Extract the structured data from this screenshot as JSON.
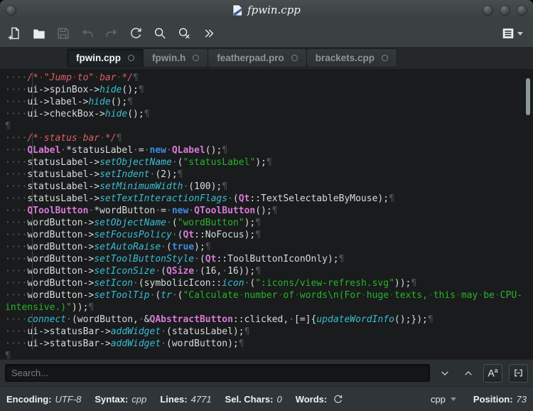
{
  "window": {
    "title": "fpwin.cpp"
  },
  "titlebar": {
    "left_buttons": [
      {
        "name": "window-menu-button"
      }
    ],
    "right_buttons": [
      {
        "name": "minimize-button"
      },
      {
        "name": "maximize-button"
      },
      {
        "name": "close-button"
      }
    ],
    "title_icon": "featherpad-document-icon"
  },
  "toolbar": {
    "buttons": [
      {
        "name": "new-file",
        "icon": "new-file-icon",
        "enabled": true
      },
      {
        "name": "open-file",
        "icon": "open-folder-icon",
        "enabled": true
      },
      {
        "name": "save",
        "icon": "save-icon",
        "enabled": false
      },
      {
        "name": "undo",
        "icon": "undo-icon",
        "enabled": false
      },
      {
        "name": "redo",
        "icon": "redo-icon",
        "enabled": false
      },
      {
        "name": "reload",
        "icon": "reload-icon",
        "enabled": true
      },
      {
        "name": "search",
        "icon": "search-icon",
        "enabled": true
      },
      {
        "name": "find-replace",
        "icon": "find-replace-icon",
        "enabled": true
      },
      {
        "name": "more-tools",
        "icon": "double-chevron-icon",
        "enabled": true
      }
    ],
    "menu_button_icon": "hamburger-menu-icon"
  },
  "tabs": [
    {
      "label": "fpwin.cpp",
      "active": true
    },
    {
      "label": "fpwin.h",
      "active": false
    },
    {
      "label": "featherpad.pro",
      "active": false
    },
    {
      "label": "brackets.cpp",
      "active": false
    }
  ],
  "editor": {
    "colors": {
      "editor-bg": "#191b1c",
      "plain": "#d8dbdc",
      "comment": "#e25f66",
      "string": "#2ab32a",
      "keyword": "#3f8de4",
      "type": "#d77ad7",
      "func": "#3bbcd2"
    },
    "lines": [
      {
        "i": 4,
        "t": [
          [
            "c",
            "/* \"Jump to\" bar */"
          ]
        ],
        "n": true
      },
      {
        "i": 4,
        "t": [
          [
            "p",
            "ui->spinBox->"
          ],
          [
            "f",
            "hide"
          ],
          [
            "p",
            "();"
          ]
        ],
        "n": true
      },
      {
        "i": 4,
        "t": [
          [
            "p",
            "ui->label->"
          ],
          [
            "f",
            "hide"
          ],
          [
            "p",
            "();"
          ]
        ],
        "n": true
      },
      {
        "i": 4,
        "t": [
          [
            "p",
            "ui->checkBox->"
          ],
          [
            "f",
            "hide"
          ],
          [
            "p",
            "();"
          ]
        ],
        "n": true
      },
      {
        "i": 0,
        "t": [],
        "n": true
      },
      {
        "i": 4,
        "t": [
          [
            "c",
            "/* status bar */"
          ]
        ],
        "n": true
      },
      {
        "i": 4,
        "t": [
          [
            "t",
            "QLabel"
          ],
          [
            "p",
            " *statusLabel = "
          ],
          [
            "k",
            "new"
          ],
          [
            "p",
            " "
          ],
          [
            "t",
            "QLabel"
          ],
          [
            "p",
            "();"
          ]
        ],
        "n": true
      },
      {
        "i": 4,
        "t": [
          [
            "p",
            "statusLabel->"
          ],
          [
            "f",
            "setObjectName"
          ],
          [
            "p",
            " ("
          ],
          [
            "s",
            "\"statusLabel\""
          ],
          [
            "p",
            ");"
          ]
        ],
        "n": true
      },
      {
        "i": 4,
        "t": [
          [
            "p",
            "statusLabel->"
          ],
          [
            "f",
            "setIndent"
          ],
          [
            "p",
            " (2);"
          ]
        ],
        "n": true
      },
      {
        "i": 4,
        "t": [
          [
            "p",
            "statusLabel->"
          ],
          [
            "f",
            "setMinimumWidth"
          ],
          [
            "p",
            " (100);"
          ]
        ],
        "n": true
      },
      {
        "i": 4,
        "t": [
          [
            "p",
            "statusLabel->"
          ],
          [
            "f",
            "setTextInteractionFlags"
          ],
          [
            "p",
            " ("
          ],
          [
            "t",
            "Qt"
          ],
          [
            "p",
            "::TextSelectableByMouse);"
          ]
        ],
        "n": true
      },
      {
        "i": 4,
        "t": [
          [
            "t",
            "QToolButton"
          ],
          [
            "p",
            " *wordButton = "
          ],
          [
            "k",
            "new"
          ],
          [
            "p",
            " "
          ],
          [
            "t",
            "QToolButton"
          ],
          [
            "p",
            "();"
          ]
        ],
        "n": true
      },
      {
        "i": 4,
        "t": [
          [
            "p",
            "wordButton->"
          ],
          [
            "f",
            "setObjectName"
          ],
          [
            "p",
            " ("
          ],
          [
            "s",
            "\"wordButton\""
          ],
          [
            "p",
            ");"
          ]
        ],
        "n": true
      },
      {
        "i": 4,
        "t": [
          [
            "p",
            "wordButton->"
          ],
          [
            "f",
            "setFocusPolicy"
          ],
          [
            "p",
            " ("
          ],
          [
            "t",
            "Qt"
          ],
          [
            "p",
            "::NoFocus);"
          ]
        ],
        "n": true
      },
      {
        "i": 4,
        "t": [
          [
            "p",
            "wordButton->"
          ],
          [
            "f",
            "setAutoRaise"
          ],
          [
            "p",
            " ("
          ],
          [
            "k",
            "true"
          ],
          [
            "p",
            ");"
          ]
        ],
        "n": true
      },
      {
        "i": 4,
        "t": [
          [
            "p",
            "wordButton->"
          ],
          [
            "f",
            "setToolButtonStyle"
          ],
          [
            "p",
            " ("
          ],
          [
            "t",
            "Qt"
          ],
          [
            "p",
            "::ToolButtonIconOnly);"
          ]
        ],
        "n": true
      },
      {
        "i": 4,
        "t": [
          [
            "p",
            "wordButton->"
          ],
          [
            "f",
            "setIconSize"
          ],
          [
            "p",
            " ("
          ],
          [
            "t",
            "QSize"
          ],
          [
            "p",
            " (16, 16));"
          ]
        ],
        "n": true
      },
      {
        "i": 4,
        "t": [
          [
            "p",
            "wordButton->"
          ],
          [
            "f",
            "setIcon"
          ],
          [
            "p",
            " (symbolicIcon::"
          ],
          [
            "f",
            "icon"
          ],
          [
            "p",
            " ("
          ],
          [
            "s",
            "\":icons/view-refresh.svg\""
          ],
          [
            "p",
            "));"
          ]
        ],
        "n": true
      },
      {
        "i": 4,
        "t": [
          [
            "p",
            "wordButton->"
          ],
          [
            "f",
            "setToolTip"
          ],
          [
            "p",
            " ("
          ],
          [
            "f",
            "tr"
          ],
          [
            "p",
            " ("
          ],
          [
            "s",
            "\"Calculate number of words\\n(For huge texts, this may be CPU-"
          ]
        ],
        "n": false
      },
      {
        "i": 0,
        "t": [
          [
            "s",
            "intensive.)\""
          ],
          [
            "p",
            "));"
          ]
        ],
        "n": true
      },
      {
        "i": 4,
        "t": [
          [
            "f",
            "connect"
          ],
          [
            "p",
            " (wordButton, &"
          ],
          [
            "t",
            "QAbstractButton"
          ],
          [
            "p",
            "::clicked, [=]{"
          ],
          [
            "f",
            "updateWordInfo"
          ],
          [
            "p",
            "();});"
          ]
        ],
        "n": true
      },
      {
        "i": 4,
        "t": [
          [
            "p",
            "ui->statusBar->"
          ],
          [
            "f",
            "addWidget"
          ],
          [
            "p",
            " (statusLabel);"
          ]
        ],
        "n": true
      },
      {
        "i": 4,
        "t": [
          [
            "p",
            "ui->statusBar->"
          ],
          [
            "f",
            "addWidget"
          ],
          [
            "p",
            " (wordButton);"
          ]
        ],
        "n": true
      },
      {
        "i": 0,
        "t": [],
        "n": true
      }
    ]
  },
  "search": {
    "placeholder": "Search...",
    "value": "",
    "buttons": [
      {
        "name": "find-next",
        "icon": "chevron-down-icon"
      },
      {
        "name": "find-previous",
        "icon": "chevron-up-icon"
      },
      {
        "name": "match-case",
        "icon": "match-case-icon"
      },
      {
        "name": "whole-word",
        "icon": "whole-word-icon"
      }
    ]
  },
  "statusbar": {
    "items": [
      {
        "label": "Encoding:",
        "value": "UTF-8"
      },
      {
        "label": "Syntax:",
        "value": "cpp"
      },
      {
        "label": "Lines:",
        "value": "4771"
      },
      {
        "label": "Sel. Chars:",
        "value": "0"
      },
      {
        "label": "Words:",
        "value": "",
        "refresh": true
      }
    ],
    "words_refresh_icon": "refresh-icon",
    "syntax_combo": "cpp",
    "position": {
      "label": "Position:",
      "value": "73"
    }
  }
}
